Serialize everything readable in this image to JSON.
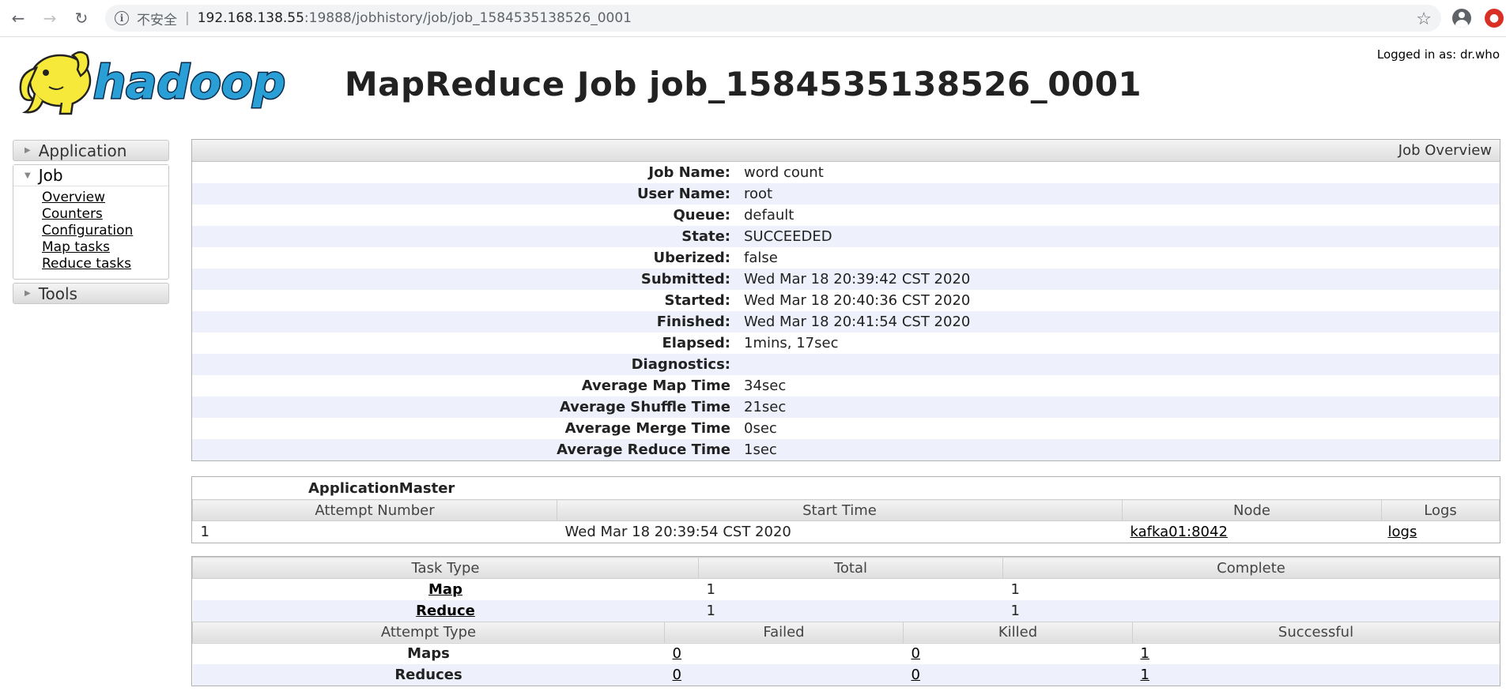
{
  "browser": {
    "security_label": "不安全",
    "url_host": "192.168.138.55",
    "url_rest": ":19888/jobhistory/job/job_1584535138526_0001"
  },
  "header": {
    "logged_in": "Logged in as: dr.who",
    "title": "MapReduce Job job_1584535138526_0001",
    "logo_text": "hadoop"
  },
  "sidebar": {
    "application": "Application",
    "job": "Job",
    "links": [
      "Overview",
      "Counters",
      "Configuration",
      "Map tasks",
      "Reduce tasks"
    ],
    "tools": "Tools"
  },
  "overview": {
    "heading": "Job Overview",
    "rows": [
      {
        "label": "Job Name:",
        "value": "word count"
      },
      {
        "label": "User Name:",
        "value": "root"
      },
      {
        "label": "Queue:",
        "value": "default"
      },
      {
        "label": "State:",
        "value": "SUCCEEDED"
      },
      {
        "label": "Uberized:",
        "value": "false"
      },
      {
        "label": "Submitted:",
        "value": "Wed Mar 18 20:39:42 CST 2020"
      },
      {
        "label": "Started:",
        "value": "Wed Mar 18 20:40:36 CST 2020"
      },
      {
        "label": "Finished:",
        "value": "Wed Mar 18 20:41:54 CST 2020"
      },
      {
        "label": "Elapsed:",
        "value": "1mins, 17sec"
      },
      {
        "label": "Diagnostics:",
        "value": ""
      },
      {
        "label": "Average Map Time",
        "value": "34sec"
      },
      {
        "label": "Average Shuffle Time",
        "value": "21sec"
      },
      {
        "label": "Average Merge Time",
        "value": "0sec"
      },
      {
        "label": "Average Reduce Time",
        "value": "1sec"
      }
    ]
  },
  "app_master": {
    "title": "ApplicationMaster",
    "headers": [
      "Attempt Number",
      "Start Time",
      "Node",
      "Logs"
    ],
    "row": {
      "attempt": "1",
      "start": "Wed Mar 18 20:39:54 CST 2020",
      "node": "kafka01:8042",
      "logs": "logs"
    }
  },
  "tasks": {
    "headers": [
      "Task Type",
      "Total",
      "Complete"
    ],
    "rows": [
      {
        "type": "Map",
        "total": "1",
        "complete": "1"
      },
      {
        "type": "Reduce",
        "total": "1",
        "complete": "1"
      }
    ]
  },
  "attempts": {
    "headers": [
      "Attempt Type",
      "Failed",
      "Killed",
      "Successful"
    ],
    "rows": [
      {
        "type": "Maps",
        "failed": "0",
        "killed": "0",
        "successful": "1"
      },
      {
        "type": "Reduces",
        "failed": "0",
        "killed": "0",
        "successful": "1"
      }
    ]
  }
}
